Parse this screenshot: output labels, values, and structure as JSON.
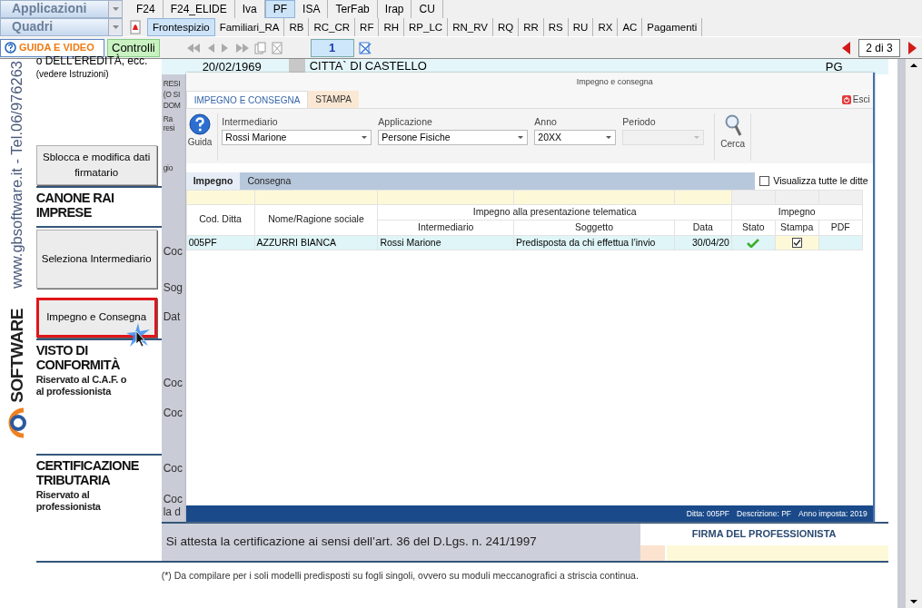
{
  "app_bar": {
    "dropdown": "Applicazioni",
    "tabs": [
      {
        "label": "F24",
        "selected": false
      },
      {
        "label": "F24_ELIDE",
        "selected": false
      },
      {
        "label": "Iva",
        "selected": false
      },
      {
        "label": "PF",
        "selected": true
      },
      {
        "label": "ISA",
        "selected": false
      },
      {
        "label": "TerFab",
        "selected": false
      },
      {
        "label": "Irap",
        "selected": false
      },
      {
        "label": "CU",
        "selected": false
      }
    ]
  },
  "quadri_bar": {
    "dropdown": "Quadri",
    "tabs": [
      {
        "label": "Frontespizio",
        "selected": true
      },
      {
        "label": "Familiari_RA",
        "selected": false
      },
      {
        "label": "RB",
        "selected": false
      },
      {
        "label": "RC_CR",
        "selected": false
      },
      {
        "label": "RF",
        "selected": false
      },
      {
        "label": "RH",
        "selected": false
      },
      {
        "label": "RP_LC",
        "selected": false
      },
      {
        "label": "RN_RV",
        "selected": false
      },
      {
        "label": "RQ",
        "selected": false
      },
      {
        "label": "RR",
        "selected": false
      },
      {
        "label": "RS",
        "selected": false
      },
      {
        "label": "RU",
        "selected": false
      },
      {
        "label": "RX",
        "selected": false
      },
      {
        "label": "AC",
        "selected": false
      },
      {
        "label": "Pagamenti",
        "selected": false
      }
    ]
  },
  "toolbar": {
    "guide_button": "GUIDA E VIDEO",
    "controls_button": "Controlli",
    "page_field": "1",
    "page_counter": "2 di 3"
  },
  "sidebar": {
    "contact": "www.gbsoftware.it - Tel.06/976263",
    "logo_text": "SOFTWARE"
  },
  "form": {
    "left_items": [
      {
        "kind": "note",
        "title": "o DELL’EREDITÀ, ecc.",
        "subtitle": "(vedere Istruzioni)"
      },
      {
        "kind": "button",
        "label": "Sblocca e modifica dati firmatario",
        "highlighted": false
      },
      {
        "kind": "section",
        "title": "CANONE RAI IMPRESE"
      },
      {
        "kind": "button",
        "label": "Seleziona Intermediario",
        "highlighted": false
      },
      {
        "kind": "button",
        "label": "Impegno e Consegna",
        "highlighted": true
      },
      {
        "kind": "section",
        "title": "VISTO DI CONFORMITÀ",
        "subtitle": "Riservato al C.A.F. o al professionista"
      },
      {
        "kind": "section",
        "title": "CERTIFICAZIONE TRIBUTARIA",
        "subtitle": "Riservato al professionista"
      }
    ],
    "birth_date": "20/02/1969",
    "city": "CITTA` DI CASTELLO",
    "province": "PG",
    "fragments": [
      "RESI",
      "(O SI",
      "DOM",
      "Ra",
      "resi",
      "gio",
      "Coc",
      "Sog",
      "Dat",
      "Coc",
      "Coc",
      "Coc",
      "Coc",
      "la d"
    ],
    "attestation": "Si attesta la certificazione ai sensi dell’art. 36 del D.Lgs. n. 241/1997",
    "signature_label": "FIRMA DEL PROFESSIONISTA",
    "footnote": "(*) Da compilare per i soli modelli predisposti su fogli singoli, ovvero su moduli meccanografici a striscia continua."
  },
  "dialog": {
    "title": "Impegno e consegna",
    "tabs": [
      {
        "label": "IMPEGNO E CONSEGNA",
        "selected": true
      },
      {
        "label": "STAMPA",
        "selected": false
      }
    ],
    "exit_button": "Esci",
    "help_button": "Guida",
    "search_button": "Cerca",
    "filters": [
      {
        "label": "Intermediario",
        "value": "Rossi Marione",
        "disabled": false
      },
      {
        "label": "Applicazione",
        "value": "Persone Fisiche",
        "disabled": false
      },
      {
        "label": "Anno",
        "value": "20XX",
        "disabled": false
      },
      {
        "label": "Periodo",
        "disabled": true
      }
    ],
    "inner_tabs": [
      {
        "label": "Impegno",
        "selected": true
      },
      {
        "label": "Consegna",
        "selected": false
      }
    ],
    "show_all": {
      "label": "Visualizza tutte le ditte",
      "checked": false
    },
    "table": {
      "columns": [
        {
          "label": "Cod. Ditta"
        },
        {
          "label": "Nome/Ragione sociale"
        },
        {
          "group": "Impegno alla presentazione telematica",
          "colspan": 3,
          "columns": [
            {
              "label": "Intermediario"
            },
            {
              "label": "Soggetto"
            },
            {
              "label": "Data"
            }
          ]
        },
        {
          "group": "Impegno",
          "colspan": 3,
          "columns": [
            {
              "label": "Stato"
            },
            {
              "label": "Stampa"
            },
            {
              "label": "PDF"
            }
          ]
        }
      ],
      "rows": [
        {
          "cells": [
            "005PF",
            "AZZURRI BIANCA",
            "Rossi Marione",
            "Predisposta da chi effettua l’invio",
            "30/04/20"
          ],
          "stato_ok": true,
          "stampa_checked": true
        }
      ]
    },
    "status_bar": [
      "Ditta: 005PF",
      "Descrizione: PF",
      "Anno imposta: 2019"
    ]
  }
}
